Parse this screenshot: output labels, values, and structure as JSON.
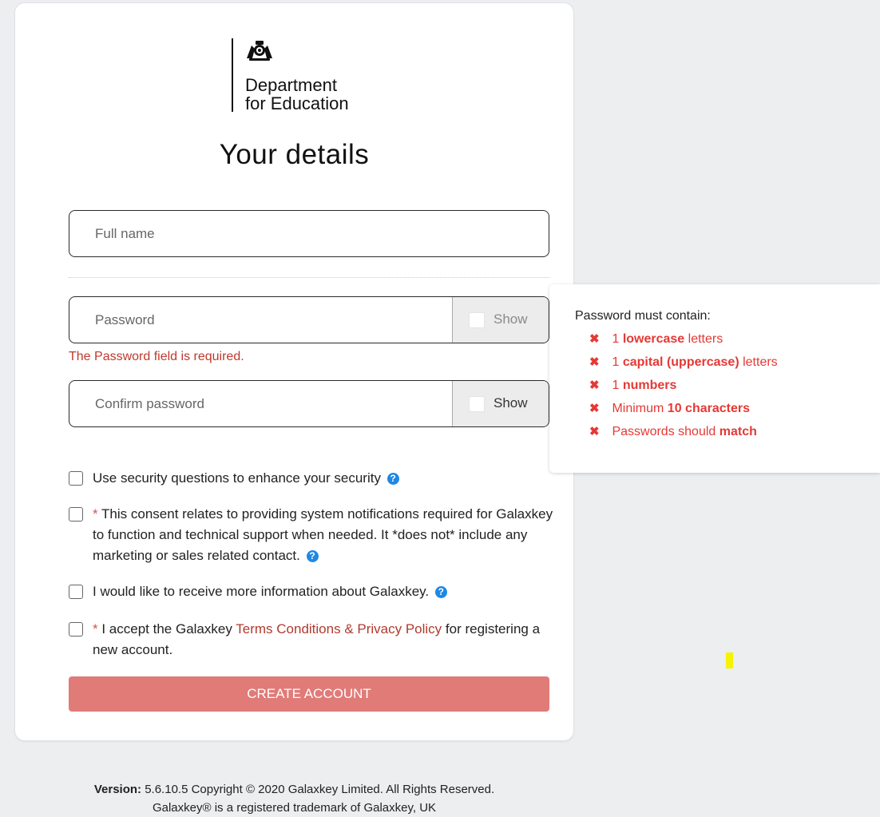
{
  "logo": {
    "line1": "Department",
    "line2": "for Education"
  },
  "page_title": "Your details",
  "form": {
    "full_name_placeholder": "Full name",
    "full_name_value": "",
    "password_placeholder": "Password",
    "password_value": "",
    "password_show_label": "Show",
    "password_error": "The Password field is required.",
    "confirm_placeholder": "Confirm password",
    "confirm_value": "",
    "confirm_show_label": "Show"
  },
  "checkboxes": {
    "security": {
      "text": "Use security questions to enhance your security"
    },
    "consent": {
      "required_mark": "*",
      "text": "This consent relates to providing system notifications required for Galaxkey to function and technical support when needed. It *does not* include any marketing or sales related contact."
    },
    "info": {
      "text": "I would like to receive more information about Galaxkey."
    },
    "terms": {
      "required_mark": "*",
      "text_before": "I accept the Galaxkey",
      "link_text": "Terms Conditions & Privacy Policy",
      "text_after": "for registering a new account."
    },
    "help_glyph": "?"
  },
  "create_button_label": "CREATE ACCOUNT",
  "footer": {
    "version_label": "Version:",
    "version_text": "5.6.10.5 Copyright © 2020 Galaxkey Limited. All Rights Reserved.",
    "trademark": "Galaxkey® is a registered trademark of Galaxkey, UK"
  },
  "password_rules": {
    "title": "Password must contain:",
    "icon": "cross-icon",
    "glyph": "✖",
    "items": [
      {
        "before": "1",
        "bold": "lowercase",
        "after": "letters"
      },
      {
        "before": "1",
        "bold": "capital (uppercase)",
        "after": "letters"
      },
      {
        "before": "1",
        "bold": "numbers",
        "after": ""
      },
      {
        "before": "Minimum",
        "bold": "10 characters",
        "after": ""
      },
      {
        "before": "Passwords should",
        "bold": "match",
        "after": ""
      }
    ]
  },
  "colors": {
    "error": "#c0392b",
    "rule_red": "#e53935",
    "button": "#e07b78",
    "help_blue": "#1e88e5",
    "page_bg": "#eceef0"
  }
}
